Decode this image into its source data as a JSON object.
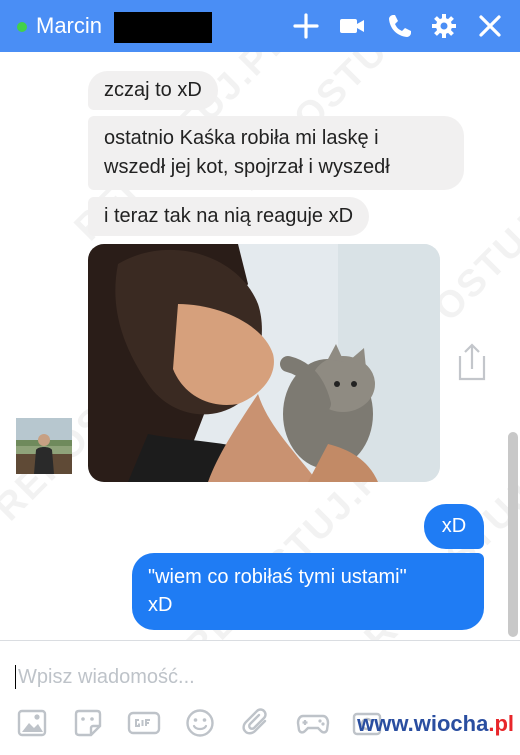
{
  "header": {
    "contact_name": "Marcin",
    "status": "online",
    "icons": [
      "add-icon",
      "video-call-icon",
      "phone-icon",
      "gear-icon",
      "close-icon"
    ]
  },
  "messages": [
    {
      "from": "them",
      "text": "zczaj to xD"
    },
    {
      "from": "them",
      "lines": [
        "ostatnio Kaśka robiła mi laskę i",
        "wszedł jej kot, spojrzał i wyszedł"
      ]
    },
    {
      "from": "them",
      "text": "i teraz tak na nią reaguje xD"
    },
    {
      "from": "them",
      "type": "photo",
      "icon": "share-icon"
    },
    {
      "from": "me",
      "text": "xD"
    },
    {
      "from": "me",
      "lines": [
        "\"wiem co robiłaś tymi ustami\"",
        "xD"
      ]
    }
  ],
  "composer": {
    "placeholder": "Wpisz wiadomość...",
    "tools": [
      "image-icon",
      "sticker-icon",
      "gif-icon",
      "emoji-icon",
      "attachment-icon",
      "game-icon",
      "camera-icon"
    ]
  },
  "watermark": "REPOSTUJ.PL",
  "brand": {
    "prefix": "www.wiocha",
    "suffix": ".pl"
  },
  "colors": {
    "header": "#4a8ef5",
    "outgoing": "#1f7cf4",
    "incoming": "#f1f0f0",
    "online": "#42d14a"
  }
}
